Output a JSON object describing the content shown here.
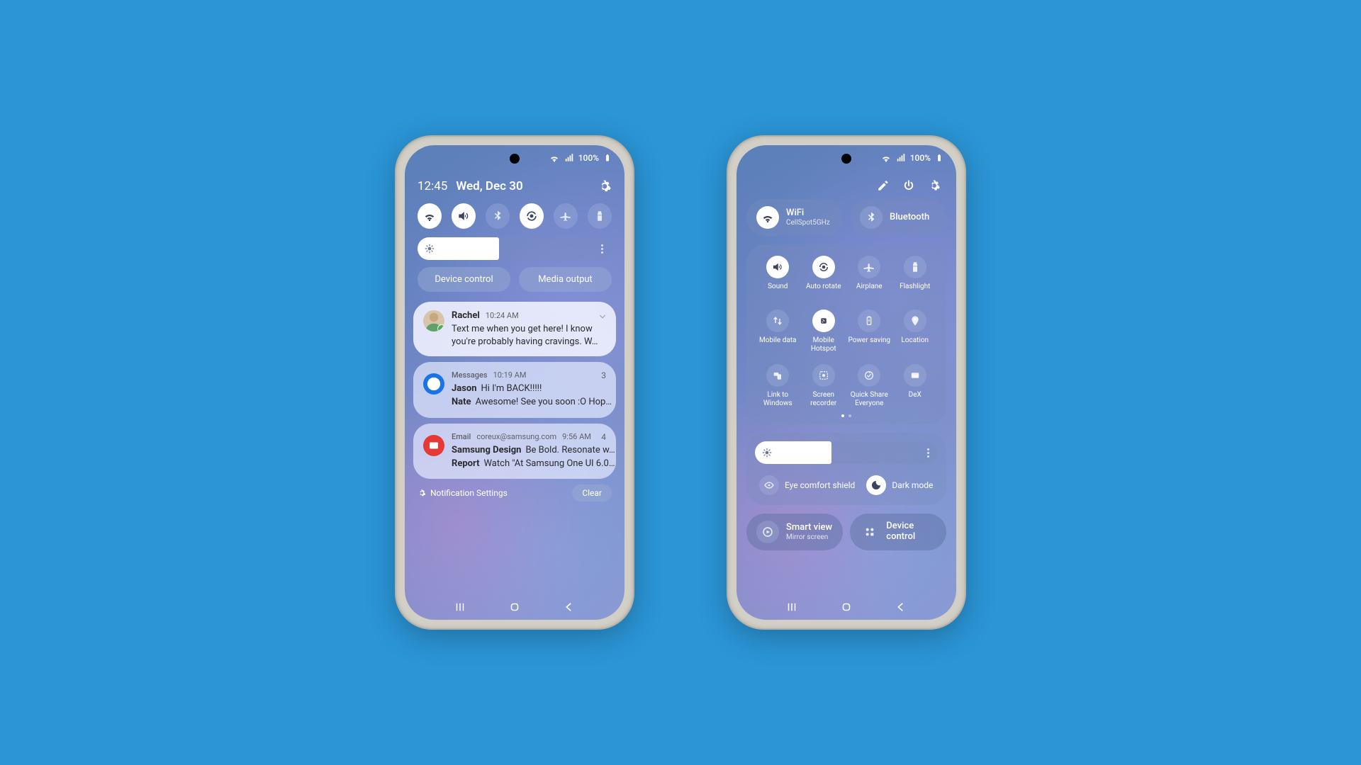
{
  "statusbar": {
    "battery_text": "100%"
  },
  "left": {
    "time": "12:45",
    "date": "Wed, Dec 30",
    "quick_toggles": [
      {
        "name": "wifi",
        "on": true
      },
      {
        "name": "sound",
        "on": true
      },
      {
        "name": "bluetooth",
        "on": false
      },
      {
        "name": "autorotate",
        "on": true
      },
      {
        "name": "airplane",
        "on": false
      },
      {
        "name": "flashlight",
        "on": false
      }
    ],
    "device_control_label": "Device control",
    "media_output_label": "Media output",
    "notifications": {
      "n0": {
        "sender": "Rachel",
        "time": "10:24 AM",
        "body": "Text me when you get here! I know you're probably having cravings. W…"
      },
      "n1": {
        "app": "Messages",
        "time": "10:19 AM",
        "count": "3",
        "rows": [
          {
            "sender": "Jason",
            "body": "Hi I'm BACK!!!!!"
          },
          {
            "sender": "Nate",
            "body": "Awesome! See you soon :O Hop…"
          }
        ]
      },
      "n2": {
        "app": "Email",
        "address": "coreux@samsung.com",
        "time": "9:56 AM",
        "count": "4",
        "rows": [
          {
            "sender": "Samsung Design",
            "body": "Be Bold. Resonate w…"
          },
          {
            "sender": "Report",
            "body": "Watch \"At Samsung One UI 6.0…"
          }
        ]
      }
    },
    "settings_label": "Notification Settings",
    "clear_label": "Clear"
  },
  "right": {
    "wifi": {
      "label": "WiFi",
      "sub": "CellSpot5GHz",
      "on": true
    },
    "bluetooth": {
      "label": "Bluetooth",
      "on": false
    },
    "grid": [
      {
        "name": "sound",
        "label": "Sound",
        "on": true
      },
      {
        "name": "autorotate",
        "label": "Auto rotate",
        "on": true
      },
      {
        "name": "airplane",
        "label": "Airplane",
        "on": false
      },
      {
        "name": "flashlight",
        "label": "Flashlight",
        "on": false
      },
      {
        "name": "mobiledata",
        "label": "Mobile data",
        "on": false
      },
      {
        "name": "hotspot",
        "label": "Mobile Hotspot",
        "on": true
      },
      {
        "name": "powersaving",
        "label": "Power saving",
        "on": false
      },
      {
        "name": "location",
        "label": "Location",
        "on": false
      },
      {
        "name": "linkwindows",
        "label": "Link to Windows",
        "on": false
      },
      {
        "name": "screenrecord",
        "label": "Screen recorder",
        "on": false
      },
      {
        "name": "quickshare",
        "label": "Quick Share Everyone",
        "on": false
      },
      {
        "name": "dex",
        "label": "DeX",
        "on": false
      }
    ],
    "eye_comfort_label": "Eye comfort shield",
    "dark_mode_label": "Dark mode",
    "smart_view": {
      "label": "Smart view",
      "sub": "Mirror screen"
    },
    "device_control_label": "Device control"
  }
}
